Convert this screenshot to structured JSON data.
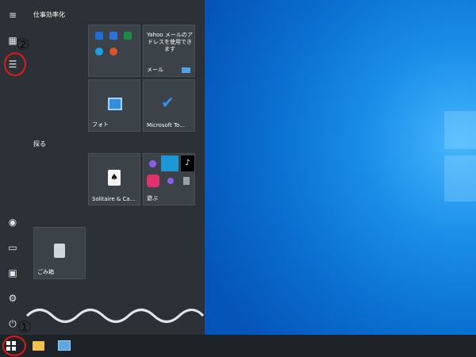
{
  "start_menu": {
    "group_title_1": "仕事効率化",
    "group_title_2": "探る",
    "tiles": {
      "office_group_label": "",
      "yahoo_text": "Yahoo メールのアドレスを使用できます",
      "mail_label": "メール",
      "photos_label": "フォト",
      "todo_label": "Microsoft To...",
      "solitaire_label": "Solitaire & Ca...",
      "play_label": "遊ぶ",
      "recycle_label": "ごみ箱"
    }
  },
  "annotations": {
    "one": "①",
    "two": "②"
  },
  "colors": {
    "accent_red": "#e21818",
    "menu_bg": "#2b3136",
    "taskbar_bg": "#1e2328",
    "wallpaper_blue": "#0a6fd0"
  }
}
